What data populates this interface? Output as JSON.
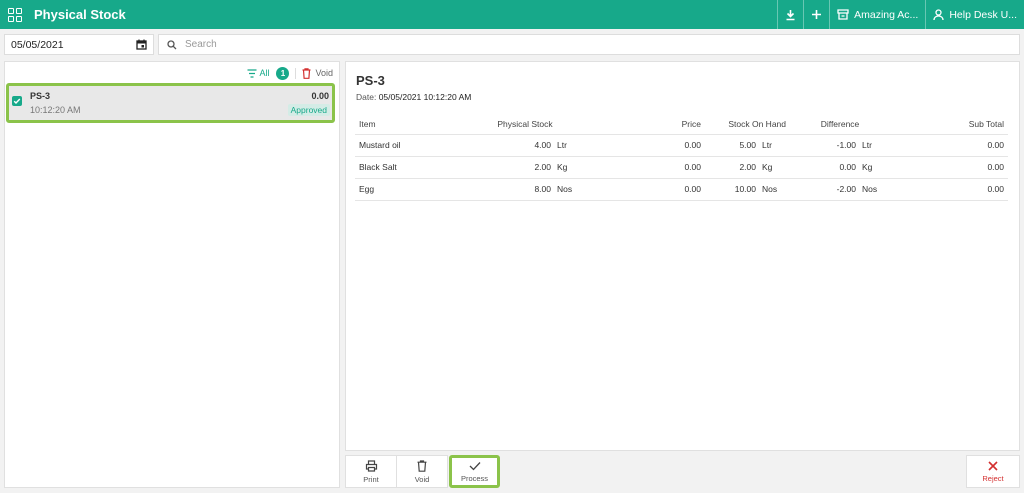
{
  "colors": {
    "accent": "#17a98a",
    "highlight": "#8bc34a",
    "reject": "#d32f2f"
  },
  "header": {
    "title": "Physical Stock",
    "company_label": "Amazing Ac...",
    "user_label": "Help Desk U..."
  },
  "filter": {
    "date_value": "05/05/2021",
    "search_placeholder": "Search"
  },
  "list": {
    "all_label": "All",
    "count": "1",
    "void_label": "Void",
    "items": [
      {
        "code": "PS-3",
        "time": "10:12:20 AM",
        "amount": "0.00",
        "status": "Approved"
      }
    ]
  },
  "detail": {
    "title": "PS-3",
    "date_label": "Date:",
    "date_value": "05/05/2021 10:12:20 AM",
    "columns": [
      "Item",
      "Physical Stock",
      "Price",
      "Stock On Hand",
      "Difference",
      "Sub Total"
    ],
    "rows": [
      {
        "item": "Mustard oil",
        "physical": "4.00",
        "physical_unit": "Ltr",
        "price": "0.00",
        "onhand": "5.00",
        "onhand_unit": "Ltr",
        "diff": "-1.00",
        "diff_unit": "Ltr",
        "subtotal": "0.00"
      },
      {
        "item": "Black Salt",
        "physical": "2.00",
        "physical_unit": "Kg",
        "price": "0.00",
        "onhand": "2.00",
        "onhand_unit": "Kg",
        "diff": "0.00",
        "diff_unit": "Kg",
        "subtotal": "0.00"
      },
      {
        "item": "Egg",
        "physical": "8.00",
        "physical_unit": "Nos",
        "price": "0.00",
        "onhand": "10.00",
        "onhand_unit": "Nos",
        "diff": "-2.00",
        "diff_unit": "Nos",
        "subtotal": "0.00"
      }
    ]
  },
  "actions": {
    "print": "Print",
    "void": "Void",
    "process": "Process",
    "reject": "Reject"
  }
}
